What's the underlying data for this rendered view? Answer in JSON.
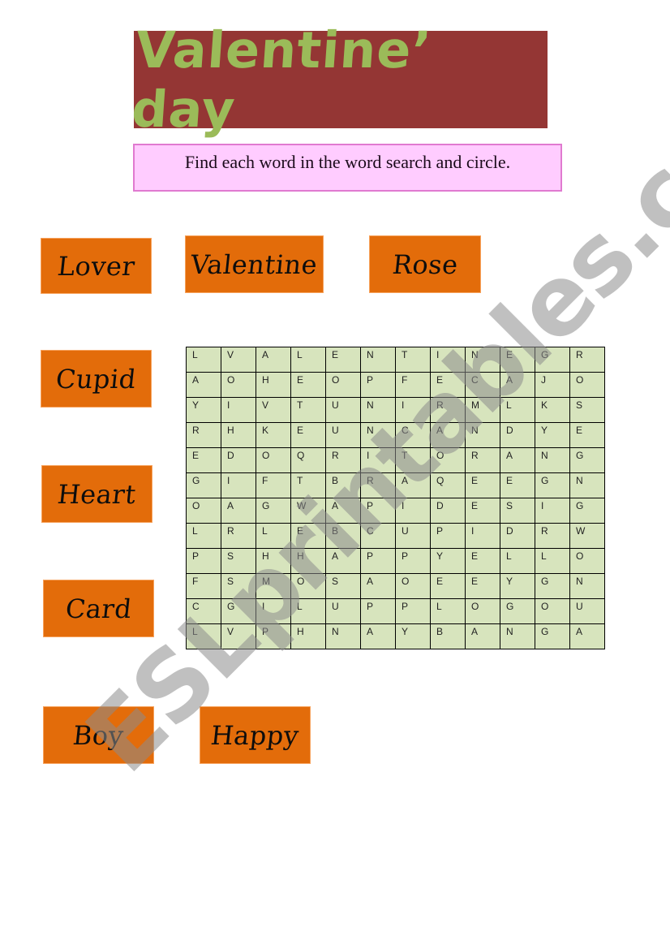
{
  "title": "Valentine’ day",
  "instruction": "Find each word in the word search and circle.",
  "words": [
    "Lover",
    "Valentine",
    "Rose",
    "Cupid",
    "Heart",
    "Card",
    "Boy",
    "Happy"
  ],
  "grid": [
    [
      "L",
      "V",
      "A",
      "L",
      "E",
      "N",
      "T",
      "I",
      "N",
      "E",
      "G",
      "R"
    ],
    [
      "A",
      "O",
      "H",
      "E",
      "O",
      "P",
      "F",
      "E",
      "C",
      "A",
      "J",
      "O"
    ],
    [
      "Y",
      "I",
      "V",
      "T",
      "U",
      "N",
      "I",
      "R",
      "M",
      "L",
      "K",
      "S"
    ],
    [
      "R",
      "H",
      "K",
      "E",
      "U",
      "N",
      "C",
      "A",
      "N",
      "D",
      "Y",
      "E"
    ],
    [
      "E",
      "D",
      "O",
      "Q",
      "R",
      "I",
      "T",
      "O",
      "R",
      "A",
      "N",
      "G"
    ],
    [
      "G",
      "I",
      "F",
      "T",
      "B",
      "R",
      "A",
      "Q",
      "E",
      "E",
      "G",
      "N"
    ],
    [
      "O",
      "A",
      "G",
      "W",
      "A",
      "P",
      "I",
      "D",
      "E",
      "S",
      "I",
      "G"
    ],
    [
      "L",
      "R",
      "L",
      "E",
      "B",
      "C",
      "U",
      "P",
      "I",
      "D",
      "R",
      "W"
    ],
    [
      "P",
      "S",
      "H",
      "H",
      "A",
      "P",
      "P",
      "Y",
      "E",
      "L",
      "L",
      "O"
    ],
    [
      "F",
      "S",
      "M",
      "O",
      "S",
      "A",
      "O",
      "E",
      "E",
      "Y",
      "G",
      "N"
    ],
    [
      "C",
      "G",
      "I",
      "L",
      "U",
      "P",
      "P",
      "L",
      "O",
      "G",
      "O",
      "U"
    ],
    [
      "L",
      "V",
      "P",
      "H",
      "N",
      "A",
      "Y",
      "B",
      "A",
      "N",
      "G",
      "A"
    ]
  ],
  "watermark": "ESLprintables.com",
  "colors": {
    "banner": "#943634",
    "title_text": "#9bbb59",
    "instruction_bg": "#ffccff",
    "card": "#e36c0a",
    "grid_bg": "#d7e4bd"
  }
}
